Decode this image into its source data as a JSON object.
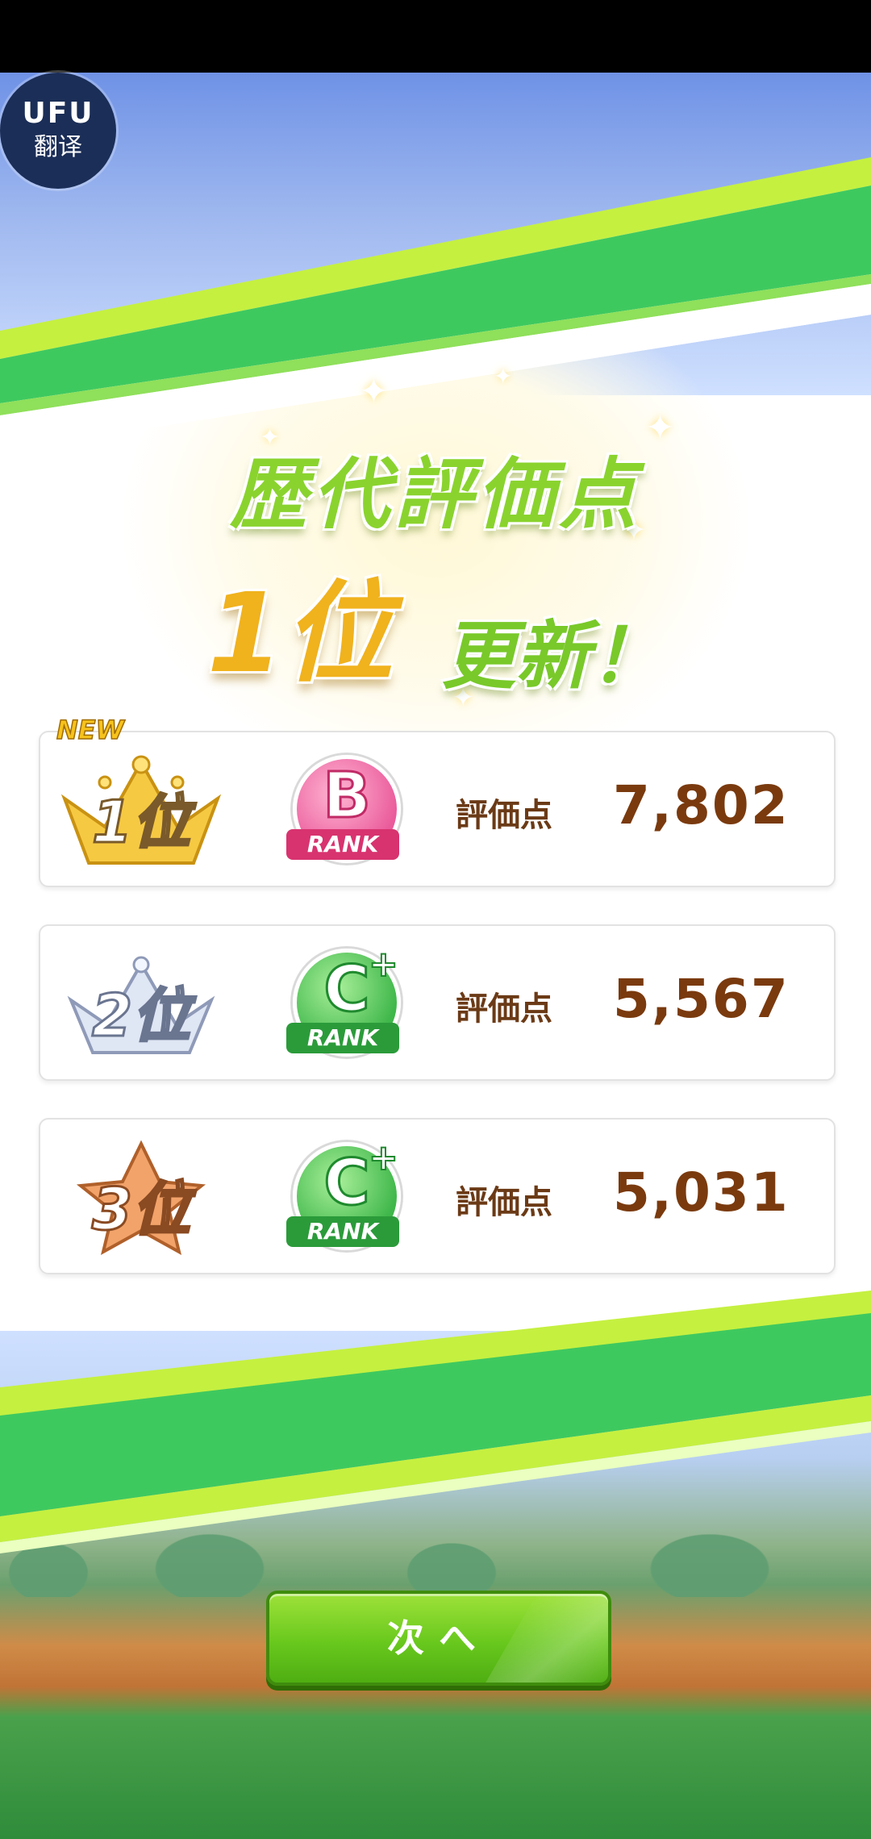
{
  "overlay": {
    "logo_text": "UFU",
    "label": "翻译"
  },
  "headline": {
    "title": "歴代評価点",
    "rank": "1位",
    "updated": "更新！"
  },
  "rankings": [
    {
      "place": "1位",
      "is_new": true,
      "new_label": "NEW",
      "rank_letter": "B",
      "rank_suffix": "",
      "rank_label": "RANK",
      "score_label": "評価点",
      "score": "7,802",
      "crown": "gold-crown-icon",
      "badge_color": "#ea5b9b"
    },
    {
      "place": "2位",
      "is_new": false,
      "new_label": "",
      "rank_letter": "C",
      "rank_suffix": "+",
      "rank_label": "RANK",
      "score_label": "評価点",
      "score": "5,567",
      "crown": "silver-crown-icon",
      "badge_color": "#3fb74a"
    },
    {
      "place": "3位",
      "is_new": false,
      "new_label": "",
      "rank_letter": "C",
      "rank_suffix": "+",
      "rank_label": "RANK",
      "score_label": "評価点",
      "score": "5,031",
      "crown": "bronze-star-icon",
      "badge_color": "#3fb74a"
    }
  ],
  "next_button": {
    "label": "次へ"
  },
  "colors": {
    "green_stripe": "#3ec95f",
    "lime_stripe": "#c5f040",
    "score_text": "#7a3a0e",
    "gold": "#f0b21d"
  }
}
